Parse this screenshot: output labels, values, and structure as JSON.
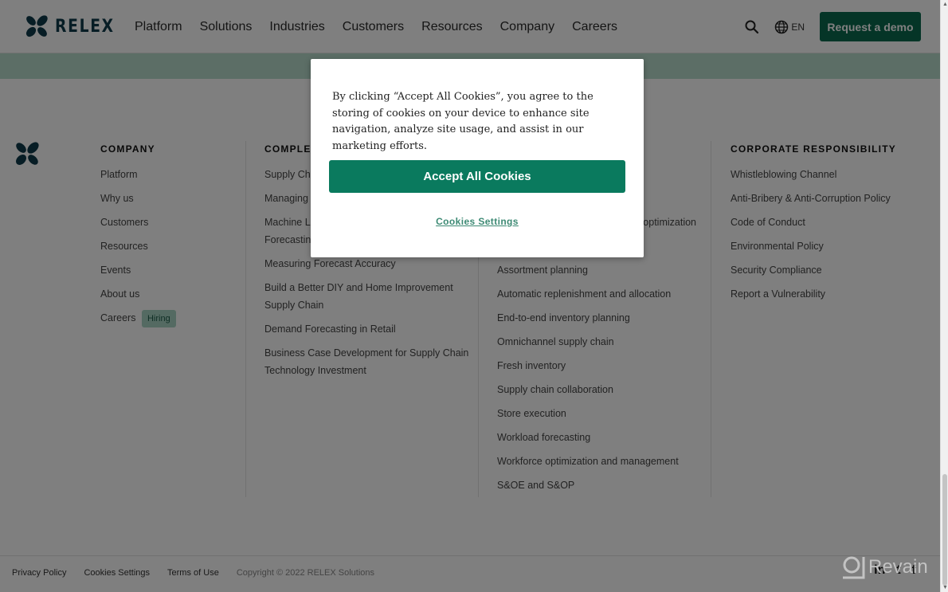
{
  "header": {
    "brand": "RELEX",
    "nav": [
      "Platform",
      "Solutions",
      "Industries",
      "Customers",
      "Resources",
      "Company",
      "Careers"
    ],
    "language": "EN",
    "demo_button": "Request a demo"
  },
  "footer": {
    "columns": [
      {
        "title": "COMPANY",
        "links": [
          "Platform",
          "Why us",
          "Customers",
          "Resources",
          "Events",
          "About us",
          "Careers"
        ],
        "badge": "Hiring"
      },
      {
        "title": "COMPLET",
        "links": [
          "Supply Cha",
          "Managing",
          "Machine Le",
          "Forecastin",
          "Measuring Forecast Accuracy",
          "Build a Better DIY and Home Improvement",
          "Supply Chain",
          "Demand Forecasting in Retail",
          "Business Case Development for Supply Chain",
          "Technology Investment"
        ]
      },
      {
        "title": "",
        "links": [
          "optimization",
          "Assortment planning",
          "Automatic replenishment and allocation",
          "End-to-end inventory planning",
          "Omnichannel supply chain",
          "Fresh inventory",
          "Supply chain collaboration",
          "Store execution",
          "Workload forecasting",
          "Workforce optimization and management",
          "S&OE and S&OP"
        ]
      },
      {
        "title": "CORPORATE RESPONSIBILITY",
        "links": [
          "Whistleblowing Channel",
          "Anti-Bribery & Anti-Corruption Policy",
          "Code of Conduct",
          "Environmental Policy",
          "Security Compliance",
          "Report a Vulnerability"
        ]
      }
    ],
    "bottom_links": [
      "Privacy Policy",
      "Cookies Settings",
      "Terms of Use"
    ],
    "copyright": "Copyright © 2022 RELEX Solutions",
    "social": [
      "in",
      "t",
      "f"
    ]
  },
  "cookie_modal": {
    "text": "By clicking “Accept All Cookies”, you agree to the storing of cookies on your device to enhance site navigation, analyze site usage, and assist in our marketing efforts.",
    "accept_button": "Accept All Cookies",
    "settings_link": "Cookies Settings"
  },
  "watermark": "Revain",
  "colors": {
    "brand_green": "#0a6b4f",
    "accept_green": "#0a7a5e",
    "band": "#b8dccc",
    "logo_navy": "#0f3a4a"
  }
}
